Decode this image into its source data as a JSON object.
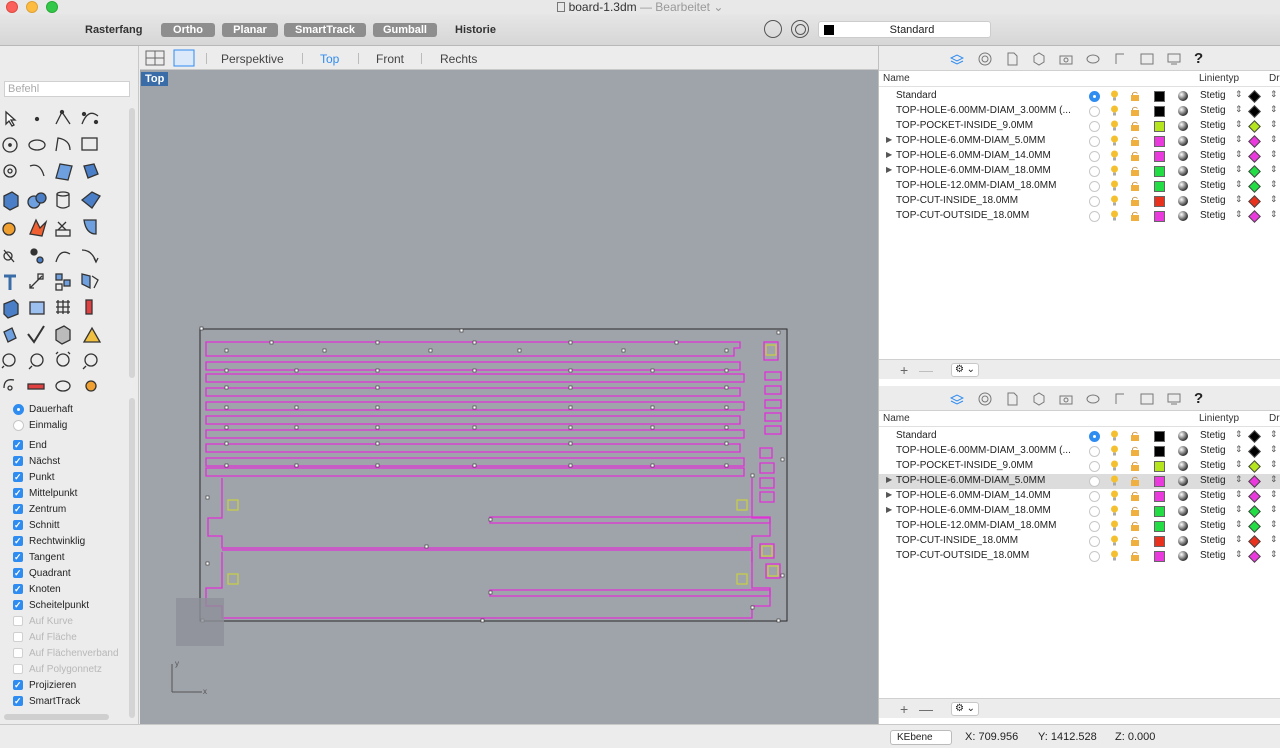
{
  "window": {
    "title": "board-1.3dm",
    "status": "— Bearbeitet ⌄"
  },
  "toolbar": {
    "rasterfang": "Rasterfang",
    "ortho": "Ortho",
    "planar": "Planar",
    "smarttrack": "SmartTrack",
    "gumball": "Gumball",
    "historie": "Historie",
    "current_layer": "Standard"
  },
  "command": {
    "placeholder": "Befehl"
  },
  "viewport_tabs": [
    "Perspektive",
    "Top",
    "Front",
    "Rechts"
  ],
  "viewport": {
    "label": "Top",
    "axis_y": "y",
    "axis_x": "x"
  },
  "osnap": {
    "mode_permanent": "Dauerhaft",
    "mode_once": "Einmalig",
    "items": [
      {
        "label": "End",
        "checked": true
      },
      {
        "label": "Nächst",
        "checked": true
      },
      {
        "label": "Punkt",
        "checked": true
      },
      {
        "label": "Mittelpunkt",
        "checked": true
      },
      {
        "label": "Zentrum",
        "checked": true
      },
      {
        "label": "Schnitt",
        "checked": true
      },
      {
        "label": "Rechtwinklig",
        "checked": true
      },
      {
        "label": "Tangent",
        "checked": true
      },
      {
        "label": "Quadrant",
        "checked": true
      },
      {
        "label": "Knoten",
        "checked": true
      },
      {
        "label": "Scheitelpunkt",
        "checked": true
      },
      {
        "label": "Auf Kurve",
        "checked": false
      },
      {
        "label": "Auf Fläche",
        "checked": false
      },
      {
        "label": "Auf Flächenverband",
        "checked": false
      },
      {
        "label": "Auf Polygonnetz",
        "checked": false
      },
      {
        "label": "Projizieren",
        "checked": true
      },
      {
        "label": "SmartTrack",
        "checked": true
      }
    ]
  },
  "layers_panel": {
    "col_name": "Name",
    "col_linetype": "Linientyp",
    "col_print": "Dr",
    "layers": [
      {
        "name": "Standard",
        "color": "#000000",
        "expand": false,
        "current": true,
        "linetype": "Stetig",
        "print_color": "#000000"
      },
      {
        "name": "TOP-HOLE-6.00MM-DIAM_3.00MM (...",
        "color": "#000000",
        "expand": false,
        "current": false,
        "linetype": "Stetig",
        "print_color": "#000000"
      },
      {
        "name": "TOP-POCKET-INSIDE_9.0MM",
        "color": "#b5e61d",
        "expand": false,
        "current": false,
        "linetype": "Stetig",
        "print_color": "#b5e61d"
      },
      {
        "name": "TOP-HOLE-6.0MM-DIAM_5.0MM",
        "color": "#ea3ade",
        "expand": true,
        "current": false,
        "linetype": "Stetig",
        "print_color": "#ea3ade"
      },
      {
        "name": "TOP-HOLE-6.0MM-DIAM_14.0MM",
        "color": "#ea3ade",
        "expand": true,
        "current": false,
        "linetype": "Stetig",
        "print_color": "#ea3ade"
      },
      {
        "name": "TOP-HOLE-6.0MM-DIAM_18.0MM",
        "color": "#22dd44",
        "expand": true,
        "current": false,
        "linetype": "Stetig",
        "print_color": "#22dd44"
      },
      {
        "name": "TOP-HOLE-12.0MM-DIAM_18.0MM",
        "color": "#22dd44",
        "expand": false,
        "current": false,
        "linetype": "Stetig",
        "print_color": "#22dd44"
      },
      {
        "name": "TOP-CUT-INSIDE_18.0MM",
        "color": "#e8321e",
        "expand": false,
        "current": false,
        "linetype": "Stetig",
        "print_color": "#e8321e"
      },
      {
        "name": "TOP-CUT-OUTSIDE_18.0MM",
        "color": "#ea3ade",
        "expand": false,
        "current": false,
        "linetype": "Stetig",
        "print_color": "#ea3ade"
      }
    ],
    "selected_index_bottom": 3,
    "add": "+",
    "remove": "—"
  },
  "status": {
    "cplane": "KEbene",
    "x": "X: 709.956",
    "y": "Y: 1412.528",
    "z": "Z: 0.000"
  }
}
